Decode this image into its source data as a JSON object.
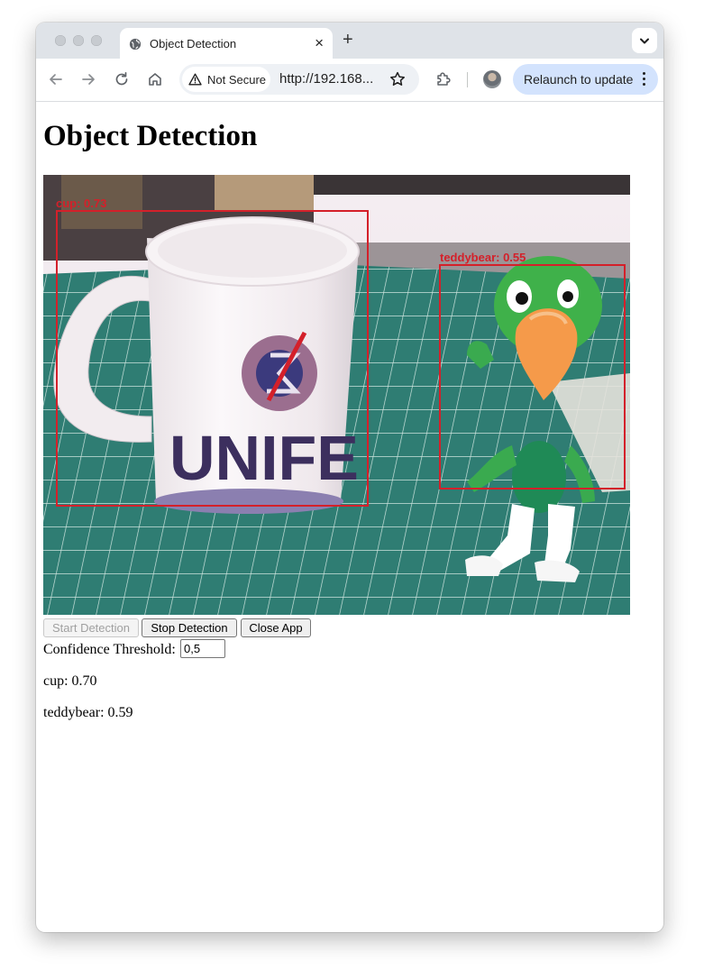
{
  "browser": {
    "tab": {
      "title": "Object Detection",
      "close": "×"
    },
    "new_tab": "+",
    "omnibox": {
      "security": "Not Secure",
      "url": "http://192.168..."
    },
    "relaunch": "Relaunch to update"
  },
  "page": {
    "title": "Object Detection",
    "video": {
      "detections": [
        {
          "label": "cup: 0.73"
        },
        {
          "label": "teddybear: 0.55"
        }
      ],
      "mug_text": "UNIFE",
      "box_color": "#d4202a"
    },
    "buttons": {
      "start": "Start Detection",
      "stop": "Stop Detection",
      "close": "Close App"
    },
    "threshold": {
      "label": "Confidence Threshold:",
      "value": "0,5"
    },
    "results": [
      "cup: 0.70",
      "teddybear: 0.59"
    ]
  }
}
